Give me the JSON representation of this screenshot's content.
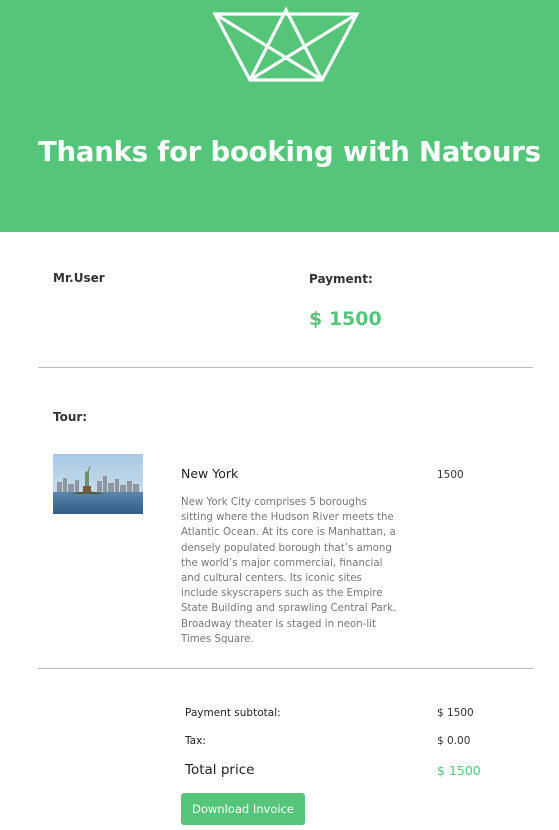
{
  "header": {
    "title": "Thanks for booking with Natours",
    "logo_icon": "crown-logo-icon",
    "background_color": "#55c57a"
  },
  "customer": {
    "name": "Mr.User"
  },
  "payment": {
    "label": "Payment:",
    "amount": "$ 1500",
    "accent_color": "#55c57a"
  },
  "tour": {
    "label": "Tour:",
    "name": "New York",
    "price": "1500",
    "image_icon": "statue-of-liberty-skyline-image",
    "description": "New York City comprises 5 boroughs sitting where the Hudson River meets the Atlantic Ocean. At its core is Manhattan, a densely populated borough that’s among the world’s major commercial, financial and cultural centers. Its iconic sites include skyscrapers such as the Empire State Building and sprawling Central Park. Broadway theater is staged in neon-lit Times Square."
  },
  "summary": {
    "subtotal_label": "Payment subtotal:",
    "subtotal_value": "$ 1500",
    "tax_label": "Tax:",
    "tax_value": "$ 0.00",
    "total_label": "Total price",
    "total_value": "$ 1500"
  },
  "actions": {
    "download_label": "Download Invoice"
  }
}
